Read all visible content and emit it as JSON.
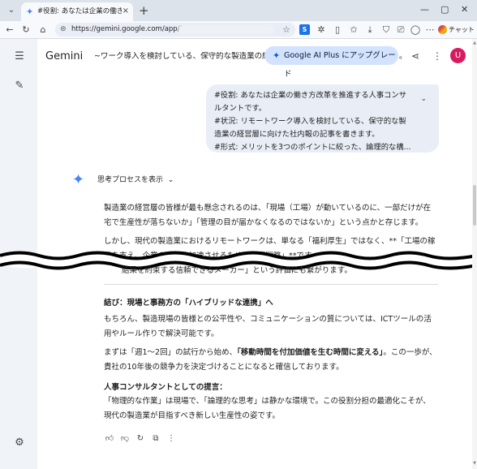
{
  "browser": {
    "tab_title": "#役割: あなたは企業の働き方改革を推",
    "tab_close": "×",
    "new_tab": "+",
    "url": "https://gemini.google.com/app/1",
    "chat_label": "チャット",
    "ext_label": "S",
    "window_controls": {
      "minimize": "—",
      "maximize": "▢",
      "close": "✕"
    }
  },
  "app": {
    "title": "Gemini",
    "conversation_title": "~ワーク導入を検討している、保守的な製造業の経",
    "conversation_title_tail": "。",
    "upgrade_label": "Google AI Plus にアップグレード",
    "avatar_initial": "U"
  },
  "prompt": {
    "lines": [
      "#役割: あなたは企業の働き方改革を推進する人事コンサ",
      "ルタントです。",
      "#状況: リモートワーク導入を検討している、保守的な製",
      "造業の経営層に向けた社内報の記事を書きます。",
      "#形式: メリットを3つのポイントに絞った、論理的な構..."
    ]
  },
  "response": {
    "thinking_label": "思考プロセスを表示",
    "p1": "製造業の経営層の皆様が最も懸念されるのは、「現場（工場）が動いているのに、一部だけが在宅で生産性が落ちないか」「管理の目が届かなくなるのではないか」という点かと存じます。",
    "p2": "しかし、現代の製造業におけるリモートワークは、単なる「福利厚生」ではなく、**「工場の稼働を支え、企業の成長を加速させるための経営戦略」**です。",
    "p3_fragment": "結果を約束する信頼できるメーカー」という評価にも繋がります。",
    "h1": "結び：現場と事務方の「ハイブリッドな連携」へ",
    "p4": "もちろん、製造現場の皆様との公平性や、コミュニケーションの質については、ICTツールの活用やルール作りで解決可能です。",
    "p5_pre": "まずは「週1〜2回」の試行から始め、",
    "p5_bold": "「移動時間を付加価値を生む時間に変える」",
    "p5_post": "。この一歩が、貴社の10年後の競争力を決定づけることになると確信しております。",
    "h2": "人事コンサルタントとしての提言：",
    "p6": "「物理的な作業」は現場で、「論理的な思考」は静かな環境で。この役割分担の最適化こそが、現代の製造業が目指すべき新しい生産性の姿です。"
  },
  "icons": {
    "menu": "menu-icon",
    "new_chat": "new-chat-icon",
    "settings": "gear-icon"
  },
  "colors": {
    "sidebar_bg": "#f0f4f9",
    "bubble_bg": "#e9eef6",
    "upgrade_bg": "#d3e3fd",
    "avatar_bg": "#d81b60",
    "gemini_blue": "#4285f4"
  }
}
